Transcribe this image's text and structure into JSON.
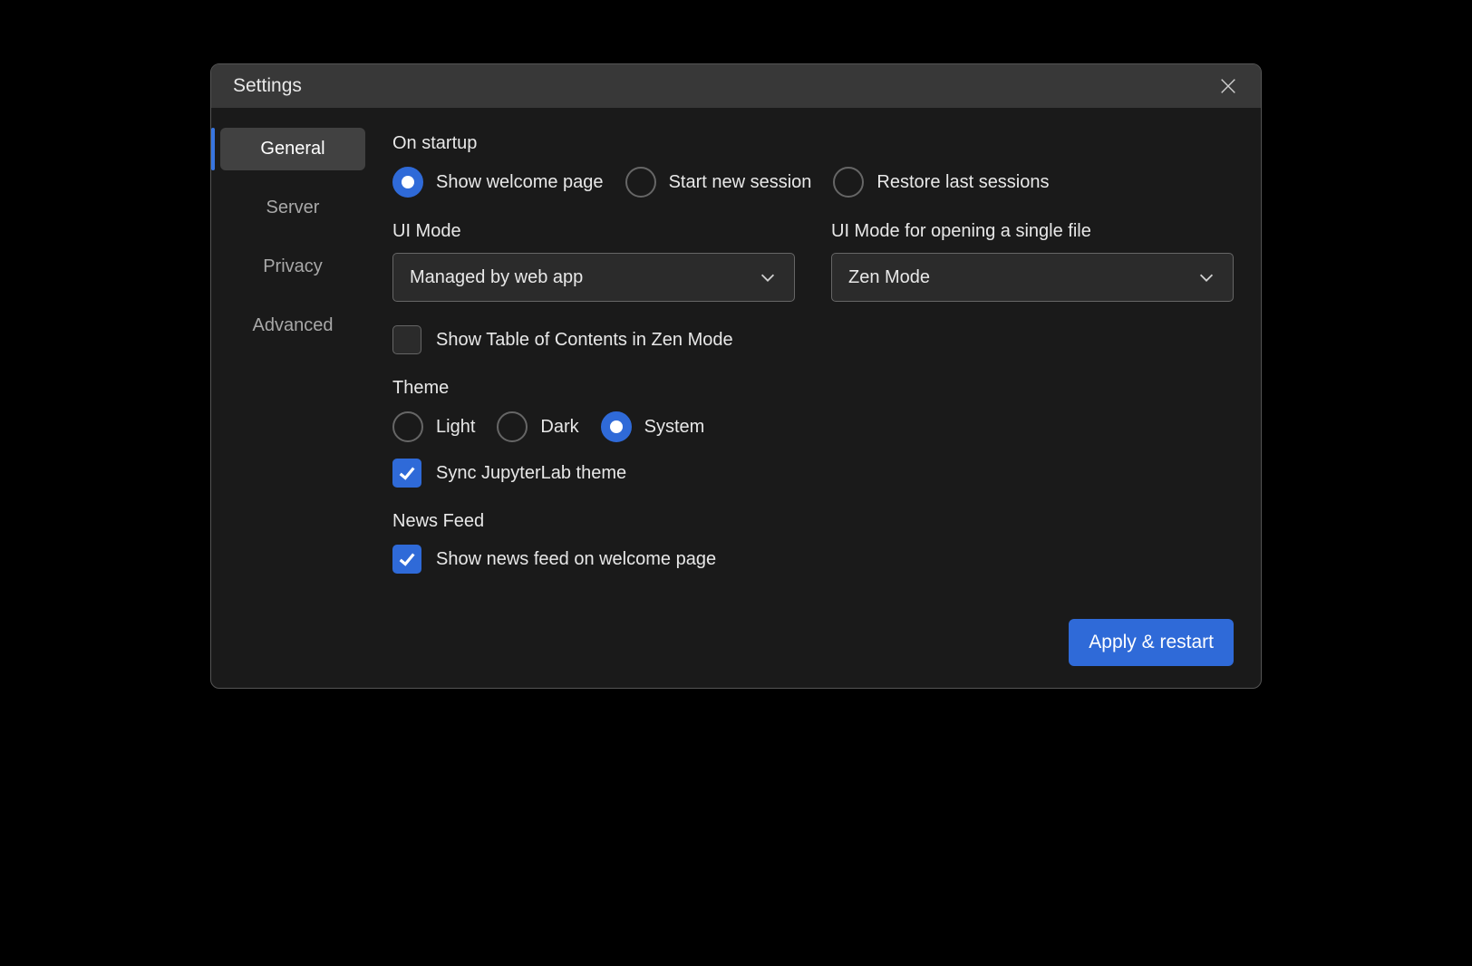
{
  "header": {
    "title": "Settings"
  },
  "sidebar": {
    "items": [
      {
        "label": "General",
        "active": true
      },
      {
        "label": "Server",
        "active": false
      },
      {
        "label": "Privacy",
        "active": false
      },
      {
        "label": "Advanced",
        "active": false
      }
    ]
  },
  "sections": {
    "startup": {
      "label": "On startup",
      "options": [
        {
          "label": "Show welcome page",
          "selected": true
        },
        {
          "label": "Start new session",
          "selected": false
        },
        {
          "label": "Restore last sessions",
          "selected": false
        }
      ]
    },
    "ui_mode": {
      "label": "UI Mode",
      "value": "Managed by web app"
    },
    "ui_mode_single": {
      "label": "UI Mode for opening a single file",
      "value": "Zen Mode"
    },
    "toc_checkbox": {
      "label": "Show Table of Contents in Zen Mode",
      "checked": false
    },
    "theme": {
      "label": "Theme",
      "options": [
        {
          "label": "Light",
          "selected": false
        },
        {
          "label": "Dark",
          "selected": false
        },
        {
          "label": "System",
          "selected": true
        }
      ]
    },
    "sync_theme": {
      "label": "Sync JupyterLab theme",
      "checked": true
    },
    "news": {
      "label": "News Feed",
      "checkbox_label": "Show news feed on welcome page",
      "checked": true
    }
  },
  "footer": {
    "apply_label": "Apply & restart"
  }
}
